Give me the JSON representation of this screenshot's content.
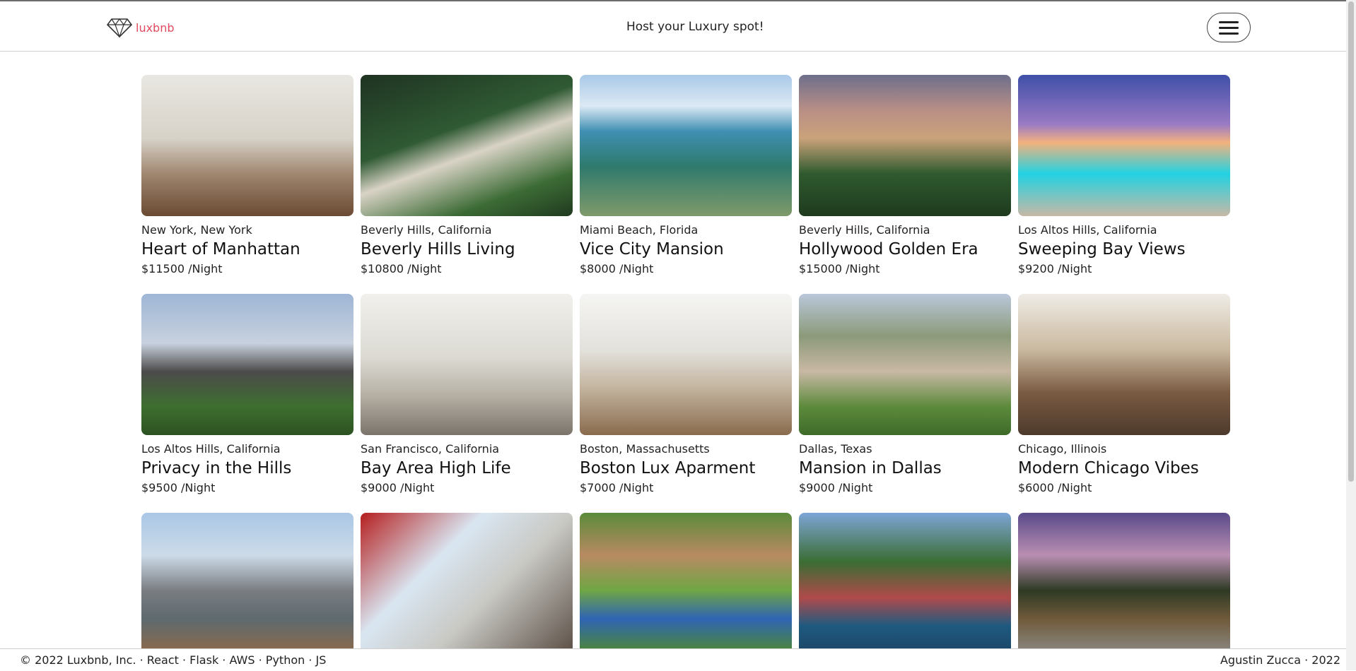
{
  "header": {
    "brand": "luxbnb",
    "host_link": "Host your Luxury spot!",
    "menu_icon": "hamburger-menu-icon",
    "brand_color": "#e24a5f",
    "logo_icon": "diamond-icon"
  },
  "listings": [
    {
      "location": "New York, New York",
      "title": "Heart of Manhattan",
      "price": "$11500 /Night",
      "scene": "living-room"
    },
    {
      "location": "Beverly Hills, California",
      "title": "Beverly Hills Living",
      "price": "$10800 /Night",
      "scene": "aerial-estate"
    },
    {
      "location": "Miami Beach, Florida",
      "title": "Vice City Mansion",
      "price": "$8000 /Night",
      "scene": "waterfront"
    },
    {
      "location": "Beverly Hills, California",
      "title": "Hollywood Golden Era",
      "price": "$15000 /Night",
      "scene": "palm-estate"
    },
    {
      "location": "Los Altos Hills, California",
      "title": "Sweeping Bay Views",
      "price": "$9200 /Night",
      "scene": "pool-sunset"
    },
    {
      "location": "Los Altos Hills, California",
      "title": "Privacy in the Hills",
      "price": "$9500 /Night",
      "scene": "modern-house"
    },
    {
      "location": "San Francisco, California",
      "title": "Bay Area High Life",
      "price": "$9000 /Night",
      "scene": "bright-living"
    },
    {
      "location": "Boston, Massachusetts",
      "title": "Boston Lux Aparment",
      "price": "$7000 /Night",
      "scene": "white-interior"
    },
    {
      "location": "Dallas, Texas",
      "title": "Mansion in Dallas",
      "price": "$9000 /Night",
      "scene": "stone-mansion"
    },
    {
      "location": "Chicago, Illinois",
      "title": "Modern Chicago Vibes",
      "price": "$6000 /Night",
      "scene": "warm-living"
    },
    {
      "location": "",
      "title": "",
      "price": "",
      "scene": "rooftop-city"
    },
    {
      "location": "",
      "title": "",
      "price": "",
      "scene": "terrace-maple"
    },
    {
      "location": "",
      "title": "",
      "price": "",
      "scene": "lawn-pool"
    },
    {
      "location": "",
      "title": "",
      "price": "",
      "scene": "lake-house"
    },
    {
      "location": "",
      "title": "",
      "price": "",
      "scene": "dusk-estate"
    }
  ],
  "footer": {
    "left": [
      "© 2022 Luxbnb, Inc.",
      "React",
      "Flask",
      "AWS",
      "Python",
      "JS"
    ],
    "separator": " · ",
    "right_author": "Agustin Zucca",
    "right_year": "2022"
  }
}
